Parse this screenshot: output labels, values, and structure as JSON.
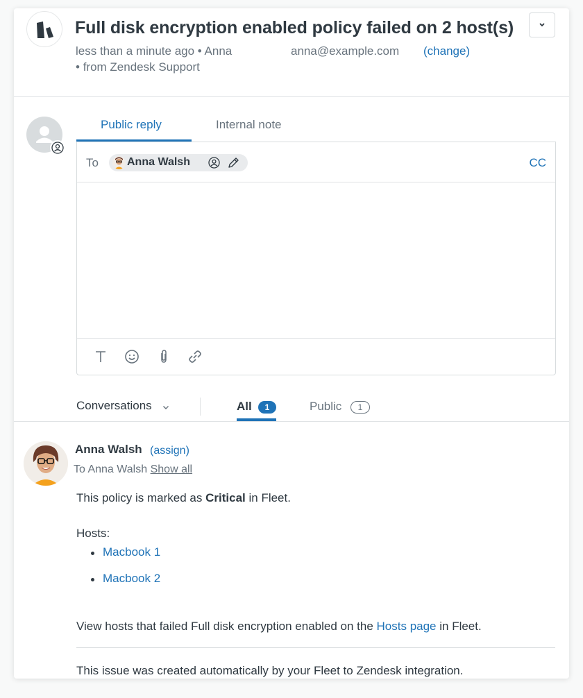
{
  "ticket": {
    "title": "Full disk encryption enabled policy failed on 2 host(s)",
    "time": "less than a minute ago",
    "requester": "Anna",
    "email": "anna@example.com",
    "change_label": "(change)",
    "via": "from Zendesk Support"
  },
  "composer": {
    "tabs": [
      "Public reply",
      "Internal note"
    ],
    "to_label": "To",
    "recipient": "Anna Walsh",
    "cc_label": "CC"
  },
  "filters": {
    "conversations_label": "Conversations",
    "all_label": "All",
    "all_count": "1",
    "public_label": "Public",
    "public_count": "1"
  },
  "message": {
    "author": "Anna Walsh",
    "assign_label": "(assign)",
    "to_prefix": "To Anna Walsh",
    "show_all": "Show all",
    "line1_pre": "This policy is marked as ",
    "line1_bold": "Critical",
    "line1_post": " in Fleet.",
    "hosts_label": "Hosts:",
    "hosts": [
      "Macbook 1",
      "Macbook 2"
    ],
    "line3_pre": "View hosts that failed Full disk encryption enabled on the ",
    "line3_link": "Hosts page",
    "line3_post": " in Fleet.",
    "footer": "This issue was created automatically by your Fleet to Zendesk integration."
  },
  "colors": {
    "accent": "#1f73b7",
    "text": "#2f3941",
    "muted": "#68737d"
  }
}
